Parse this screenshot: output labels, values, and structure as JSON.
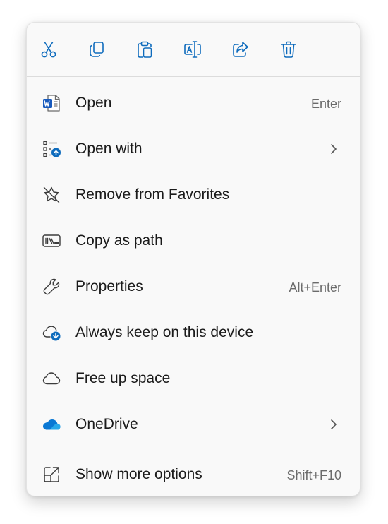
{
  "toolbar": {
    "buttons": [
      {
        "name": "cut",
        "icon": "scissors-icon"
      },
      {
        "name": "copy",
        "icon": "copy-icon"
      },
      {
        "name": "paste",
        "icon": "clipboard-icon"
      },
      {
        "name": "rename",
        "icon": "rename-icon"
      },
      {
        "name": "share",
        "icon": "share-icon"
      },
      {
        "name": "delete",
        "icon": "trash-icon"
      }
    ]
  },
  "items": {
    "open": {
      "label": "Open",
      "shortcut": "Enter",
      "icon": "word-document-icon"
    },
    "open_with": {
      "label": "Open with",
      "icon": "open-with-icon",
      "has_submenu": true
    },
    "remove_favorites": {
      "label": "Remove from Favorites",
      "icon": "star-off-icon"
    },
    "copy_path": {
      "label": "Copy as path",
      "icon": "path-icon"
    },
    "properties": {
      "label": "Properties",
      "shortcut": "Alt+Enter",
      "icon": "wrench-icon"
    },
    "always_keep": {
      "label": "Always keep on this device",
      "icon": "cloud-download-icon"
    },
    "free_up": {
      "label": "Free up space",
      "icon": "cloud-icon"
    },
    "onedrive": {
      "label": "OneDrive",
      "icon": "onedrive-icon",
      "has_submenu": true
    },
    "show_more": {
      "label": "Show more options",
      "shortcut": "Shift+F10",
      "icon": "expand-icon"
    }
  },
  "colors": {
    "accent": "#0f6cbd",
    "icon_gray": "#3c3c3c",
    "word_blue": "#185abd",
    "onedrive_blue": "#0a78d4"
  }
}
